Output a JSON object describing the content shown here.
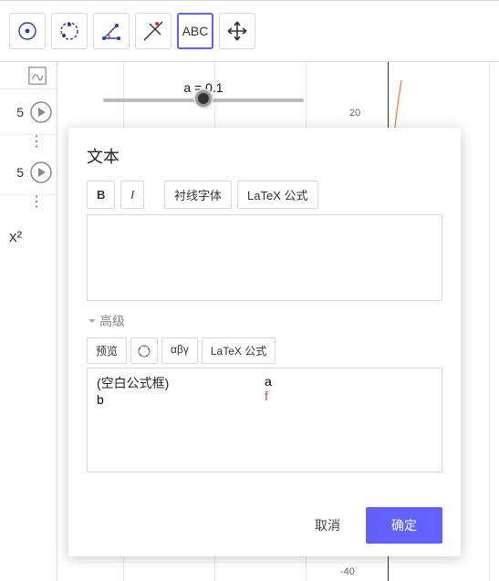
{
  "toolbar": {
    "tools": [
      {
        "name": "point-tool",
        "icon": "point"
      },
      {
        "name": "circle-point-tool",
        "icon": "circle-point"
      },
      {
        "name": "angle-tool",
        "icon": "angle"
      },
      {
        "name": "perp-tool",
        "icon": "perp"
      },
      {
        "name": "text-tool",
        "icon": "abc",
        "label": "ABC",
        "selected": true
      },
      {
        "name": "move-tool",
        "icon": "move"
      }
    ]
  },
  "left_panel": {
    "rows": [
      {
        "value": "5",
        "kind": "play"
      },
      {
        "kind": "dots"
      },
      {
        "value": "5",
        "kind": "play"
      },
      {
        "kind": "dots"
      },
      {
        "value": "x²",
        "kind": "expr"
      }
    ]
  },
  "plot": {
    "slider": {
      "label": "a = 0.1"
    },
    "y_tick": "20",
    "bottom_tick": "-40"
  },
  "dialog": {
    "title": "文本",
    "format": {
      "bold": "B",
      "italic": "I",
      "serif_font": "衬线字体",
      "latex": "LaTeX 公式"
    },
    "textarea_value": "",
    "advanced": {
      "label": "高级",
      "tabs": {
        "preview": "预览",
        "symbols": "αβγ",
        "latex": "LaTeX 公式"
      },
      "preview_rows": [
        {
          "left": "(空白公式框)",
          "right": "a",
          "right_class": ""
        },
        {
          "left": "b",
          "right": "f",
          "right_class": "pv-f"
        }
      ]
    },
    "buttons": {
      "cancel": "取消",
      "ok": "确定"
    }
  }
}
